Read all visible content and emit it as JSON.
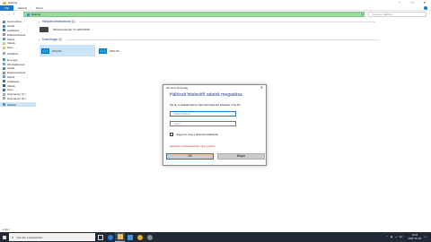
{
  "window": {
    "title": "Hálózat",
    "minimize": "─",
    "maximize": "☐",
    "close": "✕"
  },
  "ribbon": {
    "tabs": [
      "Fájl",
      "Hálózat",
      "Nézet"
    ]
  },
  "address": {
    "path": "Hálózat",
    "search_placeholder": "Keresés: Hálózat",
    "refresh": "↻",
    "back": "←",
    "forward": "→",
    "up": "↑"
  },
  "nav": {
    "items": [
      {
        "label": "Gyors elérés",
        "icon": "star-icon"
      },
      {
        "label": "Asztal",
        "icon": "desktop-icon"
      },
      {
        "label": "Letöltések",
        "icon": "download-icon"
      },
      {
        "label": "Dokumentumok",
        "icon": "documents-icon"
      },
      {
        "label": "Képek",
        "icon": "pictures-icon"
      },
      {
        "label": "Videók",
        "icon": "folder-icon"
      },
      {
        "label": "Zene",
        "icon": "folder-icon"
      },
      {
        "label": "OneDrive",
        "icon": "cloud-icon"
      },
      {
        "label": "Ez a gép",
        "icon": "pc-icon"
      },
      {
        "label": "3D objektumok",
        "icon": "objects3d-icon"
      },
      {
        "label": "Asztal",
        "icon": "desktop-icon"
      },
      {
        "label": "Dokumentumok",
        "icon": "documents-icon"
      },
      {
        "label": "Képek",
        "icon": "pictures-icon"
      },
      {
        "label": "Letöltések",
        "icon": "download-icon"
      },
      {
        "label": "Videók",
        "icon": "video-icon"
      },
      {
        "label": "Zene",
        "icon": "music-icon"
      },
      {
        "label": "Helyi lemez (C:)",
        "icon": "drive-icon"
      },
      {
        "label": "Helyi lemez (D:)",
        "icon": "drive-icon"
      },
      {
        "label": "Hálózat",
        "icon": "network-icon"
      }
    ]
  },
  "main": {
    "infra_header": "Hálózati infrastruktúra (1)",
    "router_label": "Wireless Router TL-WR740ND",
    "computers_header": "Számítógép (2)",
    "computers": [
      "KTA-PC",
      "ZNS-PC"
    ]
  },
  "dialog": {
    "title": "Windows biztonság",
    "close": "✕",
    "heading": "Hálózati hitelesítő adatok megadása",
    "description": "Írja be a csatlakozáshoz használt hitelesítő adatokat: KTA-PC",
    "username_placeholder": "Felhasználónév",
    "password_placeholder": "Jelszó",
    "remember_label": "Jegyezze meg a hitelesítő adataimat",
    "error": "Helytelen a felhasználónév vagy a jelszó",
    "ok": "OK",
    "cancel": "Mégse"
  },
  "status": {
    "items": "2 elem"
  },
  "taskbar": {
    "search": "Írjon ide a kereséshez",
    "time": "19:03",
    "date": "2018. 08. 08.",
    "lang": "HU",
    "tray_up": "^"
  },
  "colors": {
    "accent": "#1979ca",
    "address_bg": "#9adb9f",
    "taskbar": "#1f2a35",
    "error": "#c62828"
  }
}
